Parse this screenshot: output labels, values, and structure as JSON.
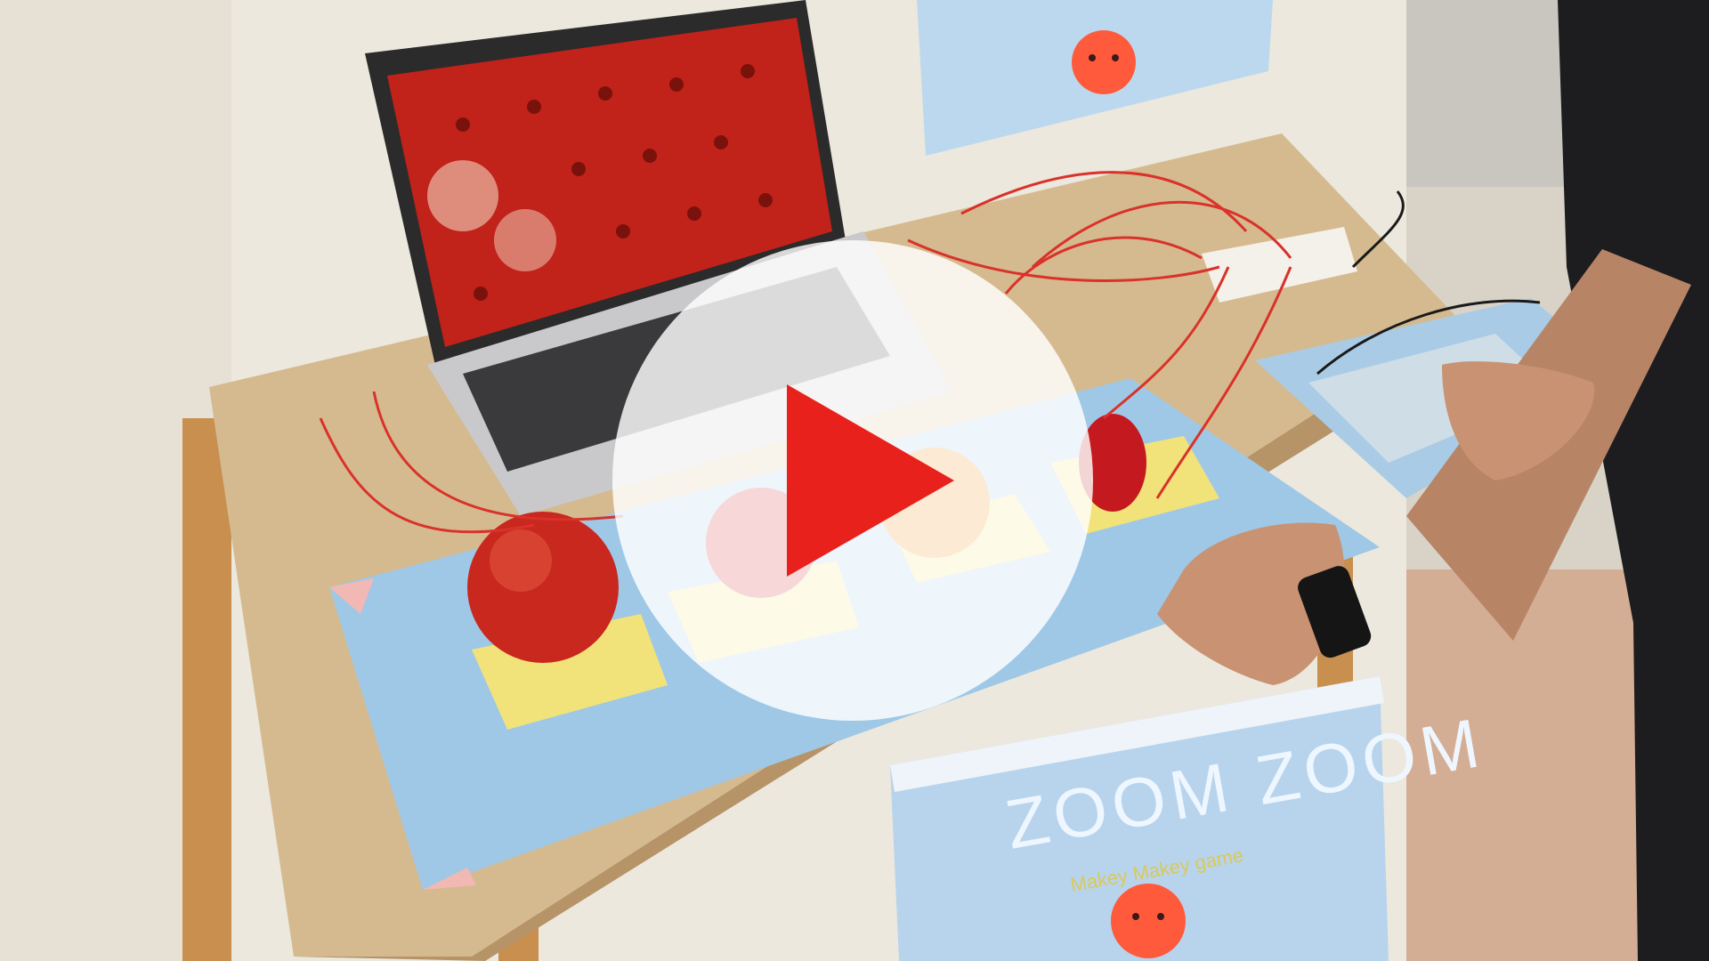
{
  "video": {
    "poster_sign_title": "ZOOM ZOOM",
    "poster_sign_subtitle": "Makey Makey game",
    "controls": {
      "play_icon": "play-icon"
    }
  },
  "colors": {
    "play_accent": "#e8211c",
    "play_disc": "#ffffff",
    "wall": "#ece8dd",
    "board_blue": "#9fc8e6",
    "pad_yellow": "#f2e27a",
    "desk_cork": "#d3b88e"
  }
}
